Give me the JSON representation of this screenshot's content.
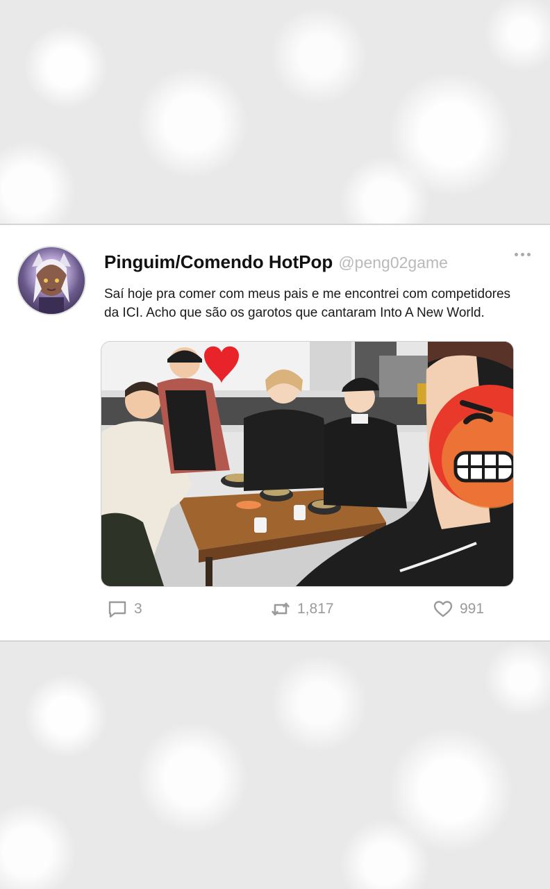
{
  "tweet": {
    "display_name": "Pinguim/Comendo HotPop",
    "handle": "@peng02game",
    "text": "Saí hoje pra comer com meus pais e me encontrei com competidores da ICI. Acho que são os garotos que cantaram Into A New World.",
    "media_caption": "",
    "stats": {
      "replies": "3",
      "retweets": "1,817",
      "likes": "991"
    }
  },
  "icons": {
    "reply": "reply-icon",
    "retweet": "retweet-icon",
    "like": "heart-icon",
    "more": "more-dots-icon"
  },
  "colors": {
    "card_background": "#ffffff",
    "text": "#111111",
    "handle": "#b9b9b9",
    "icon": "#9a9a9a",
    "heart_sticker": "#e8232a",
    "angry_emoji": "#e8392a"
  }
}
